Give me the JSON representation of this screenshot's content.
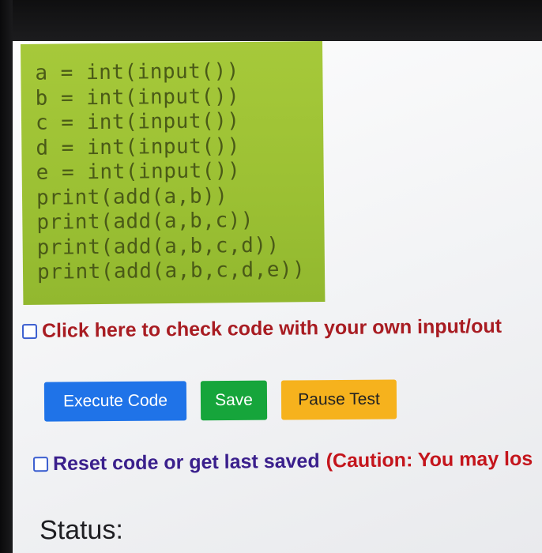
{
  "code": {
    "lines": [
      "a = int(input())",
      "b = int(input())",
      "c = int(input())",
      "d = int(input())",
      "e = int(input())",
      "print(add(a,b))",
      "print(add(a,b,c))",
      "print(add(a,b,c,d))",
      "print(add(a,b,c,d,e))"
    ]
  },
  "custom_io": {
    "label": "Click here to check code with your own input/out"
  },
  "buttons": {
    "execute": "Execute Code",
    "save": "Save",
    "pause": "Pause Test"
  },
  "reset": {
    "label": "Reset code or get last saved",
    "caution": "(Caution: You may los"
  },
  "status": {
    "label": "Status:"
  },
  "colors": {
    "code_bg": "#9bc033",
    "execute": "#1f73e8",
    "save": "#16a53b",
    "pause": "#f6b21d",
    "custom_io_text": "#a81c22",
    "reset_text": "#3a1f8c",
    "caution_text": "#c4151c"
  }
}
